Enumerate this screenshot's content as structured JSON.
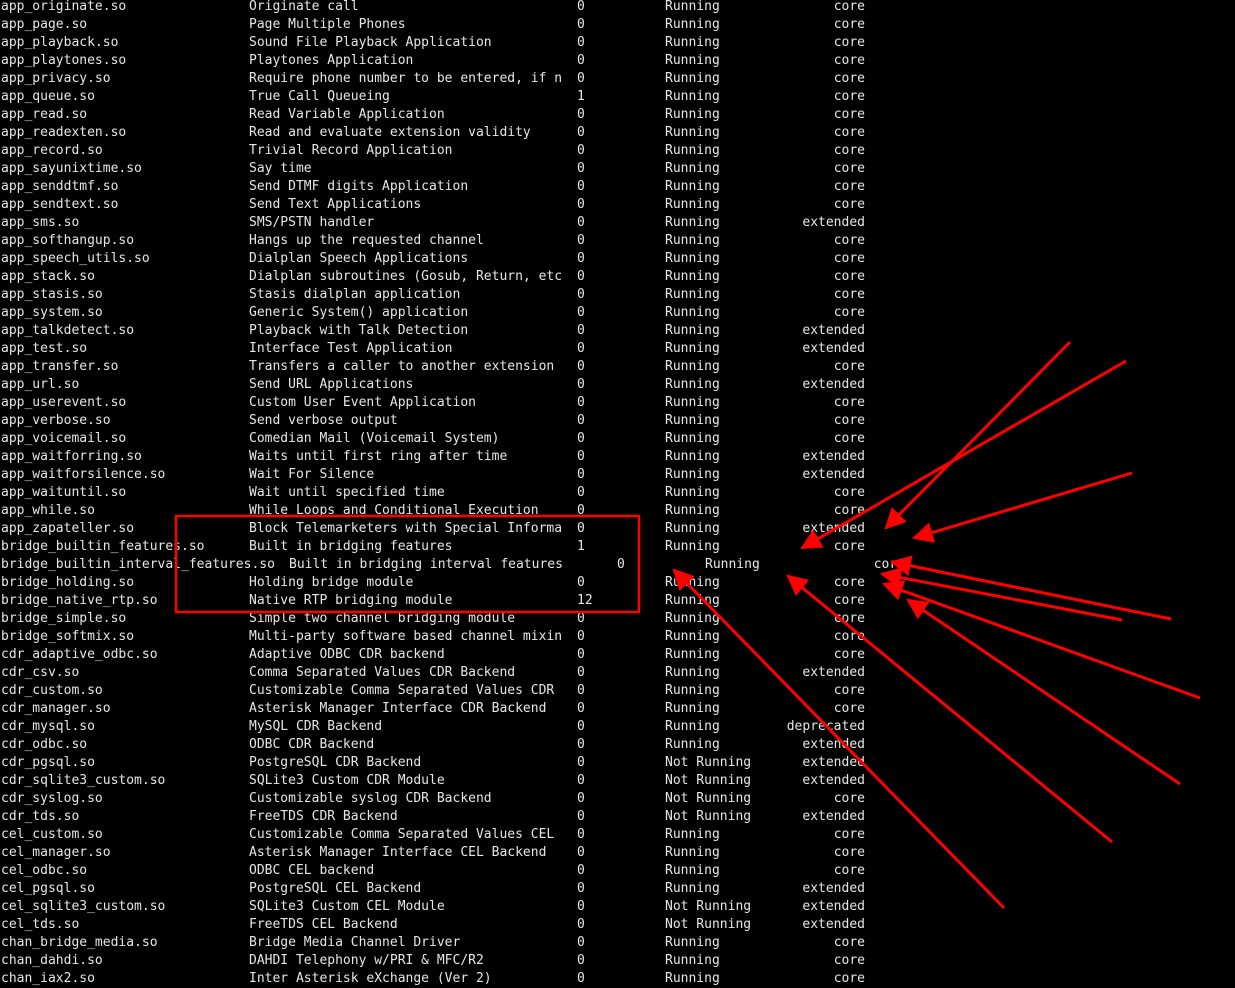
{
  "annotation_color": "#ff0000",
  "rows": [
    {
      "module": "app_originate.so",
      "description": "Originate call",
      "use": "0",
      "status": "Running",
      "support": "core"
    },
    {
      "module": "app_page.so",
      "description": "Page Multiple Phones",
      "use": "0",
      "status": "Running",
      "support": "core"
    },
    {
      "module": "app_playback.so",
      "description": "Sound File Playback Application",
      "use": "0",
      "status": "Running",
      "support": "core"
    },
    {
      "module": "app_playtones.so",
      "description": "Playtones Application",
      "use": "0",
      "status": "Running",
      "support": "core"
    },
    {
      "module": "app_privacy.so",
      "description": "Require phone number to be entered, if n",
      "use": "0",
      "status": "Running",
      "support": "core"
    },
    {
      "module": "app_queue.so",
      "description": "True Call Queueing",
      "use": "1",
      "status": "Running",
      "support": "core"
    },
    {
      "module": "app_read.so",
      "description": "Read Variable Application",
      "use": "0",
      "status": "Running",
      "support": "core"
    },
    {
      "module": "app_readexten.so",
      "description": "Read and evaluate extension validity",
      "use": "0",
      "status": "Running",
      "support": "core"
    },
    {
      "module": "app_record.so",
      "description": "Trivial Record Application",
      "use": "0",
      "status": "Running",
      "support": "core"
    },
    {
      "module": "app_sayunixtime.so",
      "description": "Say time",
      "use": "0",
      "status": "Running",
      "support": "core"
    },
    {
      "module": "app_senddtmf.so",
      "description": "Send DTMF digits Application",
      "use": "0",
      "status": "Running",
      "support": "core"
    },
    {
      "module": "app_sendtext.so",
      "description": "Send Text Applications",
      "use": "0",
      "status": "Running",
      "support": "core"
    },
    {
      "module": "app_sms.so",
      "description": "SMS/PSTN handler",
      "use": "0",
      "status": "Running",
      "support": "extended"
    },
    {
      "module": "app_softhangup.so",
      "description": "Hangs up the requested channel",
      "use": "0",
      "status": "Running",
      "support": "core"
    },
    {
      "module": "app_speech_utils.so",
      "description": "Dialplan Speech Applications",
      "use": "0",
      "status": "Running",
      "support": "core"
    },
    {
      "module": "app_stack.so",
      "description": "Dialplan subroutines (Gosub, Return, etc",
      "use": "0",
      "status": "Running",
      "support": "core"
    },
    {
      "module": "app_stasis.so",
      "description": "Stasis dialplan application",
      "use": "0",
      "status": "Running",
      "support": "core"
    },
    {
      "module": "app_system.so",
      "description": "Generic System() application",
      "use": "0",
      "status": "Running",
      "support": "core"
    },
    {
      "module": "app_talkdetect.so",
      "description": "Playback with Talk Detection",
      "use": "0",
      "status": "Running",
      "support": "extended"
    },
    {
      "module": "app_test.so",
      "description": "Interface Test Application",
      "use": "0",
      "status": "Running",
      "support": "extended"
    },
    {
      "module": "app_transfer.so",
      "description": "Transfers a caller to another extension",
      "use": "0",
      "status": "Running",
      "support": "core"
    },
    {
      "module": "app_url.so",
      "description": "Send URL Applications",
      "use": "0",
      "status": "Running",
      "support": "extended"
    },
    {
      "module": "app_userevent.so",
      "description": "Custom User Event Application",
      "use": "0",
      "status": "Running",
      "support": "core"
    },
    {
      "module": "app_verbose.so",
      "description": "Send verbose output",
      "use": "0",
      "status": "Running",
      "support": "core"
    },
    {
      "module": "app_voicemail.so",
      "description": "Comedian Mail (Voicemail System)",
      "use": "0",
      "status": "Running",
      "support": "core"
    },
    {
      "module": "app_waitforring.so",
      "description": "Waits until first ring after time",
      "use": "0",
      "status": "Running",
      "support": "extended"
    },
    {
      "module": "app_waitforsilence.so",
      "description": "Wait For Silence",
      "use": "0",
      "status": "Running",
      "support": "extended"
    },
    {
      "module": "app_waituntil.so",
      "description": "Wait until specified time",
      "use": "0",
      "status": "Running",
      "support": "core"
    },
    {
      "module": "app_while.so",
      "description": "While Loops and Conditional Execution",
      "use": "0",
      "status": "Running",
      "support": "core"
    },
    {
      "module": "app_zapateller.so",
      "description": "Block Telemarketers with Special Informa",
      "use": "0",
      "status": "Running",
      "support": "extended"
    },
    {
      "module": "bridge_builtin_features.so",
      "description": "Built in bridging features",
      "use": "1",
      "status": "Running",
      "support": "core"
    },
    {
      "module": "bridge_builtin_interval_features.so",
      "description": "Built in bridging interval features",
      "use": "0",
      "status": "Running",
      "support": "core",
      "shifted": true
    },
    {
      "module": "bridge_holding.so",
      "description": "Holding bridge module",
      "use": "0",
      "status": "Running",
      "support": "core"
    },
    {
      "module": "bridge_native_rtp.so",
      "description": "Native RTP bridging module",
      "use": "12",
      "status": "Running",
      "support": "core"
    },
    {
      "module": "bridge_simple.so",
      "description": "Simple two channel bridging module",
      "use": "0",
      "status": "Running",
      "support": "core"
    },
    {
      "module": "bridge_softmix.so",
      "description": "Multi-party software based channel mixin",
      "use": "0",
      "status": "Running",
      "support": "core"
    },
    {
      "module": "cdr_adaptive_odbc.so",
      "description": "Adaptive ODBC CDR backend",
      "use": "0",
      "status": "Running",
      "support": "core"
    },
    {
      "module": "cdr_csv.so",
      "description": "Comma Separated Values CDR Backend",
      "use": "0",
      "status": "Running",
      "support": "extended"
    },
    {
      "module": "cdr_custom.so",
      "description": "Customizable Comma Separated Values CDR",
      "use": "0",
      "status": "Running",
      "support": "core"
    },
    {
      "module": "cdr_manager.so",
      "description": "Asterisk Manager Interface CDR Backend",
      "use": "0",
      "status": "Running",
      "support": "core"
    },
    {
      "module": "cdr_mysql.so",
      "description": "MySQL CDR Backend",
      "use": "0",
      "status": "Running",
      "support": "deprecated"
    },
    {
      "module": "cdr_odbc.so",
      "description": "ODBC CDR Backend",
      "use": "0",
      "status": "Running",
      "support": "extended"
    },
    {
      "module": "cdr_pgsql.so",
      "description": "PostgreSQL CDR Backend",
      "use": "0",
      "status": "Not Running",
      "support": "extended"
    },
    {
      "module": "cdr_sqlite3_custom.so",
      "description": "SQLite3 Custom CDR Module",
      "use": "0",
      "status": "Not Running",
      "support": "extended"
    },
    {
      "module": "cdr_syslog.so",
      "description": "Customizable syslog CDR Backend",
      "use": "0",
      "status": "Not Running",
      "support": "core"
    },
    {
      "module": "cdr_tds.so",
      "description": "FreeTDS CDR Backend",
      "use": "0",
      "status": "Not Running",
      "support": "extended"
    },
    {
      "module": "cel_custom.so",
      "description": "Customizable Comma Separated Values CEL",
      "use": "0",
      "status": "Running",
      "support": "core"
    },
    {
      "module": "cel_manager.so",
      "description": "Asterisk Manager Interface CEL Backend",
      "use": "0",
      "status": "Running",
      "support": "core"
    },
    {
      "module": "cel_odbc.so",
      "description": "ODBC CEL backend",
      "use": "0",
      "status": "Running",
      "support": "core"
    },
    {
      "module": "cel_pgsql.so",
      "description": "PostgreSQL CEL Backend",
      "use": "0",
      "status": "Running",
      "support": "extended"
    },
    {
      "module": "cel_sqlite3_custom.so",
      "description": "SQLite3 Custom CEL Module",
      "use": "0",
      "status": "Not Running",
      "support": "extended"
    },
    {
      "module": "cel_tds.so",
      "description": "FreeTDS CEL Backend",
      "use": "0",
      "status": "Not Running",
      "support": "extended"
    },
    {
      "module": "chan_bridge_media.so",
      "description": "Bridge Media Channel Driver",
      "use": "0",
      "status": "Running",
      "support": "core"
    },
    {
      "module": "chan_dahdi.so",
      "description": "DAHDI Telephony w/PRI & MFC/R2",
      "use": "0",
      "status": "Running",
      "support": "core"
    },
    {
      "module": "chan_iax2.so",
      "description": "Inter Asterisk eXchange (Ver 2)",
      "use": "0",
      "status": "Running",
      "support": "core"
    }
  ]
}
